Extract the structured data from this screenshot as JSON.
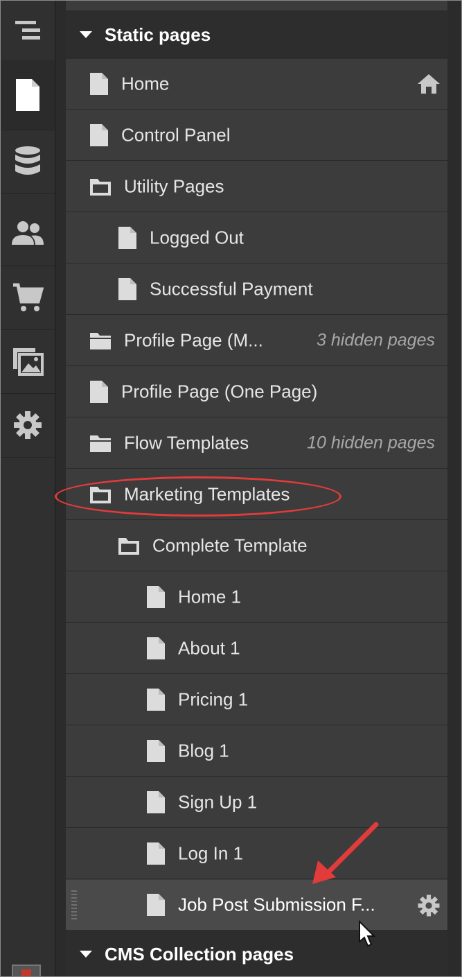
{
  "sections": {
    "static_pages": "Static pages",
    "cms_pages": "CMS Collection pages"
  },
  "rows": [
    {
      "label": "Home",
      "type": "page",
      "depth": 0,
      "trailing": "home-icon"
    },
    {
      "label": "Control Panel",
      "type": "page",
      "depth": 0
    },
    {
      "label": "Utility Pages",
      "type": "folder-open",
      "depth": 0
    },
    {
      "label": "Logged Out",
      "type": "page",
      "depth": 1
    },
    {
      "label": "Successful Payment",
      "type": "page",
      "depth": 1
    },
    {
      "label": "Profile Page (M...",
      "type": "folder-closed",
      "depth": 0,
      "hint": "3 hidden pages"
    },
    {
      "label": "Profile Page (One Page)",
      "type": "page",
      "depth": 0
    },
    {
      "label": "Flow Templates",
      "type": "folder-closed",
      "depth": 0,
      "hint": "10 hidden pages"
    },
    {
      "label": "Marketing Templates",
      "type": "folder-open",
      "depth": 0
    },
    {
      "label": "Complete Template",
      "type": "folder-open",
      "depth": 1
    },
    {
      "label": "Home 1",
      "type": "page",
      "depth": 2
    },
    {
      "label": "About 1",
      "type": "page",
      "depth": 2
    },
    {
      "label": "Pricing 1",
      "type": "page",
      "depth": 2
    },
    {
      "label": "Blog 1",
      "type": "page",
      "depth": 2
    },
    {
      "label": "Sign Up 1",
      "type": "page",
      "depth": 2
    },
    {
      "label": "Log In 1",
      "type": "page",
      "depth": 2
    },
    {
      "label": "Job Post Submission F...",
      "type": "page",
      "depth": 2,
      "trailing": "gear-icon",
      "selected": true
    }
  ],
  "rail": [
    "navigator-icon",
    "pages-icon",
    "cms-database-icon",
    "users-icon",
    "ecommerce-cart-icon",
    "assets-icon",
    "settings-gear-icon"
  ],
  "colors": {
    "annotation": "#e23b3b",
    "panel": "#3c3c3c",
    "header": "#2d2d2d",
    "selected_row": "#4a4a4a"
  }
}
